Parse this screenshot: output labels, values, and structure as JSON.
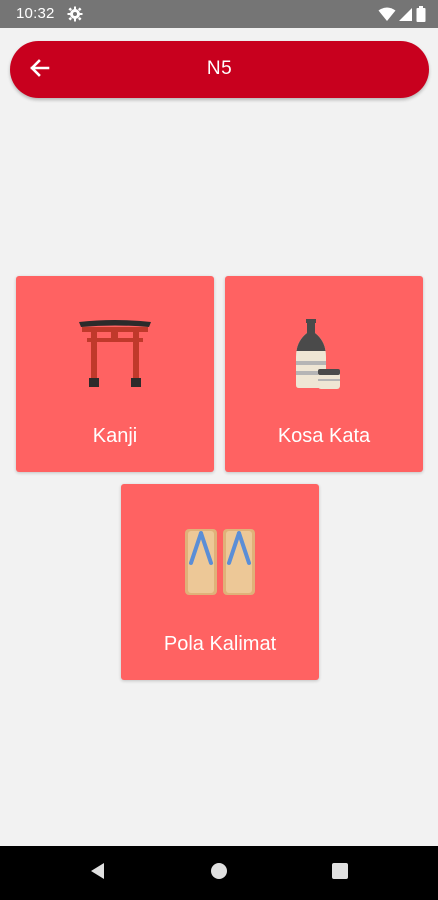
{
  "status_bar": {
    "time": "10:32",
    "icons": [
      "settings-gear-icon",
      "wifi-icon",
      "signal-icon",
      "battery-icon"
    ]
  },
  "app_bar": {
    "title": "N5",
    "back_icon": "arrow-left-icon",
    "color": "#c8001e"
  },
  "menu": {
    "card_color": "#ff6262",
    "items": [
      {
        "label": "Kanji",
        "icon": "torii-gate-icon"
      },
      {
        "label": "Kosa Kata",
        "icon": "sake-bottle-icon"
      },
      {
        "label": "Pola Kalimat",
        "icon": "geta-sandals-icon"
      }
    ]
  },
  "nav_bar": {
    "buttons": [
      "back-triangle-icon",
      "home-circle-icon",
      "recents-square-icon"
    ]
  }
}
